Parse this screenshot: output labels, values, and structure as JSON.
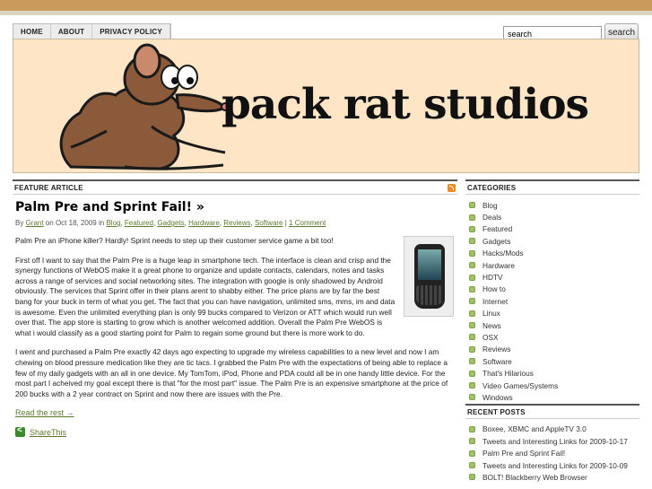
{
  "nav": [
    "HOME",
    "ABOUT",
    "PRIVACY POLICY"
  ],
  "search": {
    "value": "search",
    "button": "search"
  },
  "header": {
    "brand": "pack rat studios"
  },
  "feature": {
    "header": "FEATURE ARTICLE",
    "title": "Palm Pre and Sprint Fail! »",
    "meta_by": "By",
    "meta_author": "Grant",
    "meta_on": "on Oct 18, 2009 in",
    "tags": [
      "Blog",
      "Featured",
      "Gadgets",
      "Hardware",
      "Reviews",
      "Software"
    ],
    "comments": "1 Comment",
    "p1": "Palm Pre an iPhone killer?  Hardly!  Sprint needs to step up their customer service game a bit too!",
    "p2": "First off I want to say that the Palm Pre is a huge leap in smartphone tech.  The interface is clean and crisp and the synergy functions of WebOS make it a great phone to organize and update contacts, calendars, notes and tasks across a range of services and social networking sites.  The integration with google is only shadowed by Android obviously.  The services that Sprint offer in their plans arent to shabby either.  The price plans are by far the best bang for your buck in term of what you get.  The fact that you can have navigation, unlimited sms, mms, im and data is awesome.  Even the unlimited everything plan is only 99 bucks compared to Verizon or ATT which would run well over that.  The app store is starting to grow which is another welcomed addition.  Overall the Palm Pre WebOS is what i would classify as a good starting point for Palm to regain some ground but there is more work to do.",
    "p3": "I went and purchased a Palm Pre exactly 42 days ago expecting to upgrade my wireless capabilities to a new level and now I am chewing on blood pressure medication like they are tic tacs.  I grabbed the Palm Pre with the expectations of being able to replace a few of my daily gadgets with an all in one device.  My TomTom, iPod, Phone and PDA could all be in one handy little device.  For the most part I acheived my goal except there is that \"for the most part\" issue.  The Palm Pre is an expensive smartphone at the price of 200 bucks with a 2 year contract on Sprint  and now there are issues with the Pre.",
    "read_more": "Read the rest",
    "share": "ShareThis"
  },
  "sidebar": {
    "categories_header": "CATEGORIES",
    "categories": [
      "Blog",
      "Deals",
      "Featured",
      "Gadgets",
      "Hacks/Mods",
      "Hardware",
      "HDTV",
      "How to",
      "Internet",
      "Linux",
      "News",
      "OSX",
      "Reviews",
      "Software",
      "That's Hilarious",
      "Video Games/Systems",
      "Windows"
    ],
    "recent_header": "RECENT POSTS",
    "recent": [
      "Boxee, XBMC and AppleTV 3.0",
      "Tweets and Interesting Links for 2009-10-17",
      "Palm Pre and Sprint Fail!",
      "Tweets and Interesting Links for 2009-10-09",
      "BOLT! Blackberry Web Browser"
    ]
  }
}
